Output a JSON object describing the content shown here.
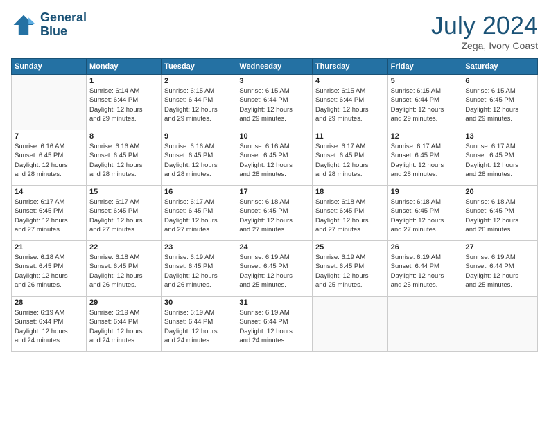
{
  "header": {
    "logo_line1": "General",
    "logo_line2": "Blue",
    "month_year": "July 2024",
    "location": "Zega, Ivory Coast"
  },
  "days_of_week": [
    "Sunday",
    "Monday",
    "Tuesday",
    "Wednesday",
    "Thursday",
    "Friday",
    "Saturday"
  ],
  "weeks": [
    [
      {
        "day": "",
        "info": ""
      },
      {
        "day": "1",
        "info": "Sunrise: 6:14 AM\nSunset: 6:44 PM\nDaylight: 12 hours\nand 29 minutes."
      },
      {
        "day": "2",
        "info": "Sunrise: 6:15 AM\nSunset: 6:44 PM\nDaylight: 12 hours\nand 29 minutes."
      },
      {
        "day": "3",
        "info": "Sunrise: 6:15 AM\nSunset: 6:44 PM\nDaylight: 12 hours\nand 29 minutes."
      },
      {
        "day": "4",
        "info": "Sunrise: 6:15 AM\nSunset: 6:44 PM\nDaylight: 12 hours\nand 29 minutes."
      },
      {
        "day": "5",
        "info": "Sunrise: 6:15 AM\nSunset: 6:44 PM\nDaylight: 12 hours\nand 29 minutes."
      },
      {
        "day": "6",
        "info": "Sunrise: 6:15 AM\nSunset: 6:45 PM\nDaylight: 12 hours\nand 29 minutes."
      }
    ],
    [
      {
        "day": "7",
        "info": ""
      },
      {
        "day": "8",
        "info": "Sunrise: 6:16 AM\nSunset: 6:45 PM\nDaylight: 12 hours\nand 28 minutes."
      },
      {
        "day": "9",
        "info": "Sunrise: 6:16 AM\nSunset: 6:45 PM\nDaylight: 12 hours\nand 28 minutes."
      },
      {
        "day": "10",
        "info": "Sunrise: 6:16 AM\nSunset: 6:45 PM\nDaylight: 12 hours\nand 28 minutes."
      },
      {
        "day": "11",
        "info": "Sunrise: 6:17 AM\nSunset: 6:45 PM\nDaylight: 12 hours\nand 28 minutes."
      },
      {
        "day": "12",
        "info": "Sunrise: 6:17 AM\nSunset: 6:45 PM\nDaylight: 12 hours\nand 28 minutes."
      },
      {
        "day": "13",
        "info": "Sunrise: 6:17 AM\nSunset: 6:45 PM\nDaylight: 12 hours\nand 28 minutes."
      }
    ],
    [
      {
        "day": "14",
        "info": ""
      },
      {
        "day": "15",
        "info": "Sunrise: 6:17 AM\nSunset: 6:45 PM\nDaylight: 12 hours\nand 27 minutes."
      },
      {
        "day": "16",
        "info": "Sunrise: 6:17 AM\nSunset: 6:45 PM\nDaylight: 12 hours\nand 27 minutes."
      },
      {
        "day": "17",
        "info": "Sunrise: 6:18 AM\nSunset: 6:45 PM\nDaylight: 12 hours\nand 27 minutes."
      },
      {
        "day": "18",
        "info": "Sunrise: 6:18 AM\nSunset: 6:45 PM\nDaylight: 12 hours\nand 27 minutes."
      },
      {
        "day": "19",
        "info": "Sunrise: 6:18 AM\nSunset: 6:45 PM\nDaylight: 12 hours\nand 27 minutes."
      },
      {
        "day": "20",
        "info": "Sunrise: 6:18 AM\nSunset: 6:45 PM\nDaylight: 12 hours\nand 26 minutes."
      }
    ],
    [
      {
        "day": "21",
        "info": ""
      },
      {
        "day": "22",
        "info": "Sunrise: 6:18 AM\nSunset: 6:45 PM\nDaylight: 12 hours\nand 26 minutes."
      },
      {
        "day": "23",
        "info": "Sunrise: 6:19 AM\nSunset: 6:45 PM\nDaylight: 12 hours\nand 26 minutes."
      },
      {
        "day": "24",
        "info": "Sunrise: 6:19 AM\nSunset: 6:45 PM\nDaylight: 12 hours\nand 25 minutes."
      },
      {
        "day": "25",
        "info": "Sunrise: 6:19 AM\nSunset: 6:45 PM\nDaylight: 12 hours\nand 25 minutes."
      },
      {
        "day": "26",
        "info": "Sunrise: 6:19 AM\nSunset: 6:44 PM\nDaylight: 12 hours\nand 25 minutes."
      },
      {
        "day": "27",
        "info": "Sunrise: 6:19 AM\nSunset: 6:44 PM\nDaylight: 12 hours\nand 25 minutes."
      }
    ],
    [
      {
        "day": "28",
        "info": "Sunrise: 6:19 AM\nSunset: 6:44 PM\nDaylight: 12 hours\nand 24 minutes."
      },
      {
        "day": "29",
        "info": "Sunrise: 6:19 AM\nSunset: 6:44 PM\nDaylight: 12 hours\nand 24 minutes."
      },
      {
        "day": "30",
        "info": "Sunrise: 6:19 AM\nSunset: 6:44 PM\nDaylight: 12 hours\nand 24 minutes."
      },
      {
        "day": "31",
        "info": "Sunrise: 6:19 AM\nSunset: 6:44 PM\nDaylight: 12 hours\nand 24 minutes."
      },
      {
        "day": "",
        "info": ""
      },
      {
        "day": "",
        "info": ""
      },
      {
        "day": "",
        "info": ""
      }
    ]
  ],
  "week7_day7_info": "Sunrise: 6:16 AM\nSunset: 6:45 PM\nDaylight: 12 hours\nand 28 minutes.",
  "week14_info": "Sunrise: 6:17 AM\nSunset: 6:45 PM\nDaylight: 12 hours\nand 27 minutes.",
  "week21_info": "Sunrise: 6:18 AM\nSunset: 6:45 PM\nDaylight: 12 hours\nand 26 minutes."
}
